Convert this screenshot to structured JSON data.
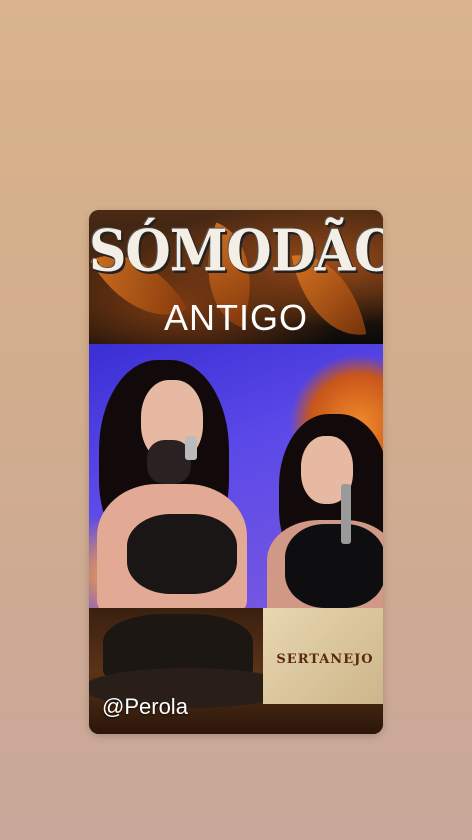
{
  "story": {
    "title_main": "SÓMODÃO",
    "title_sub": "ANTIGO",
    "username": "@Perola",
    "sertanejo_label": "SERTANEJO"
  },
  "colors": {
    "background_top": "#d9b48c",
    "background_bottom": "#c9a79a",
    "stage_blue": "#3a2fd4"
  }
}
